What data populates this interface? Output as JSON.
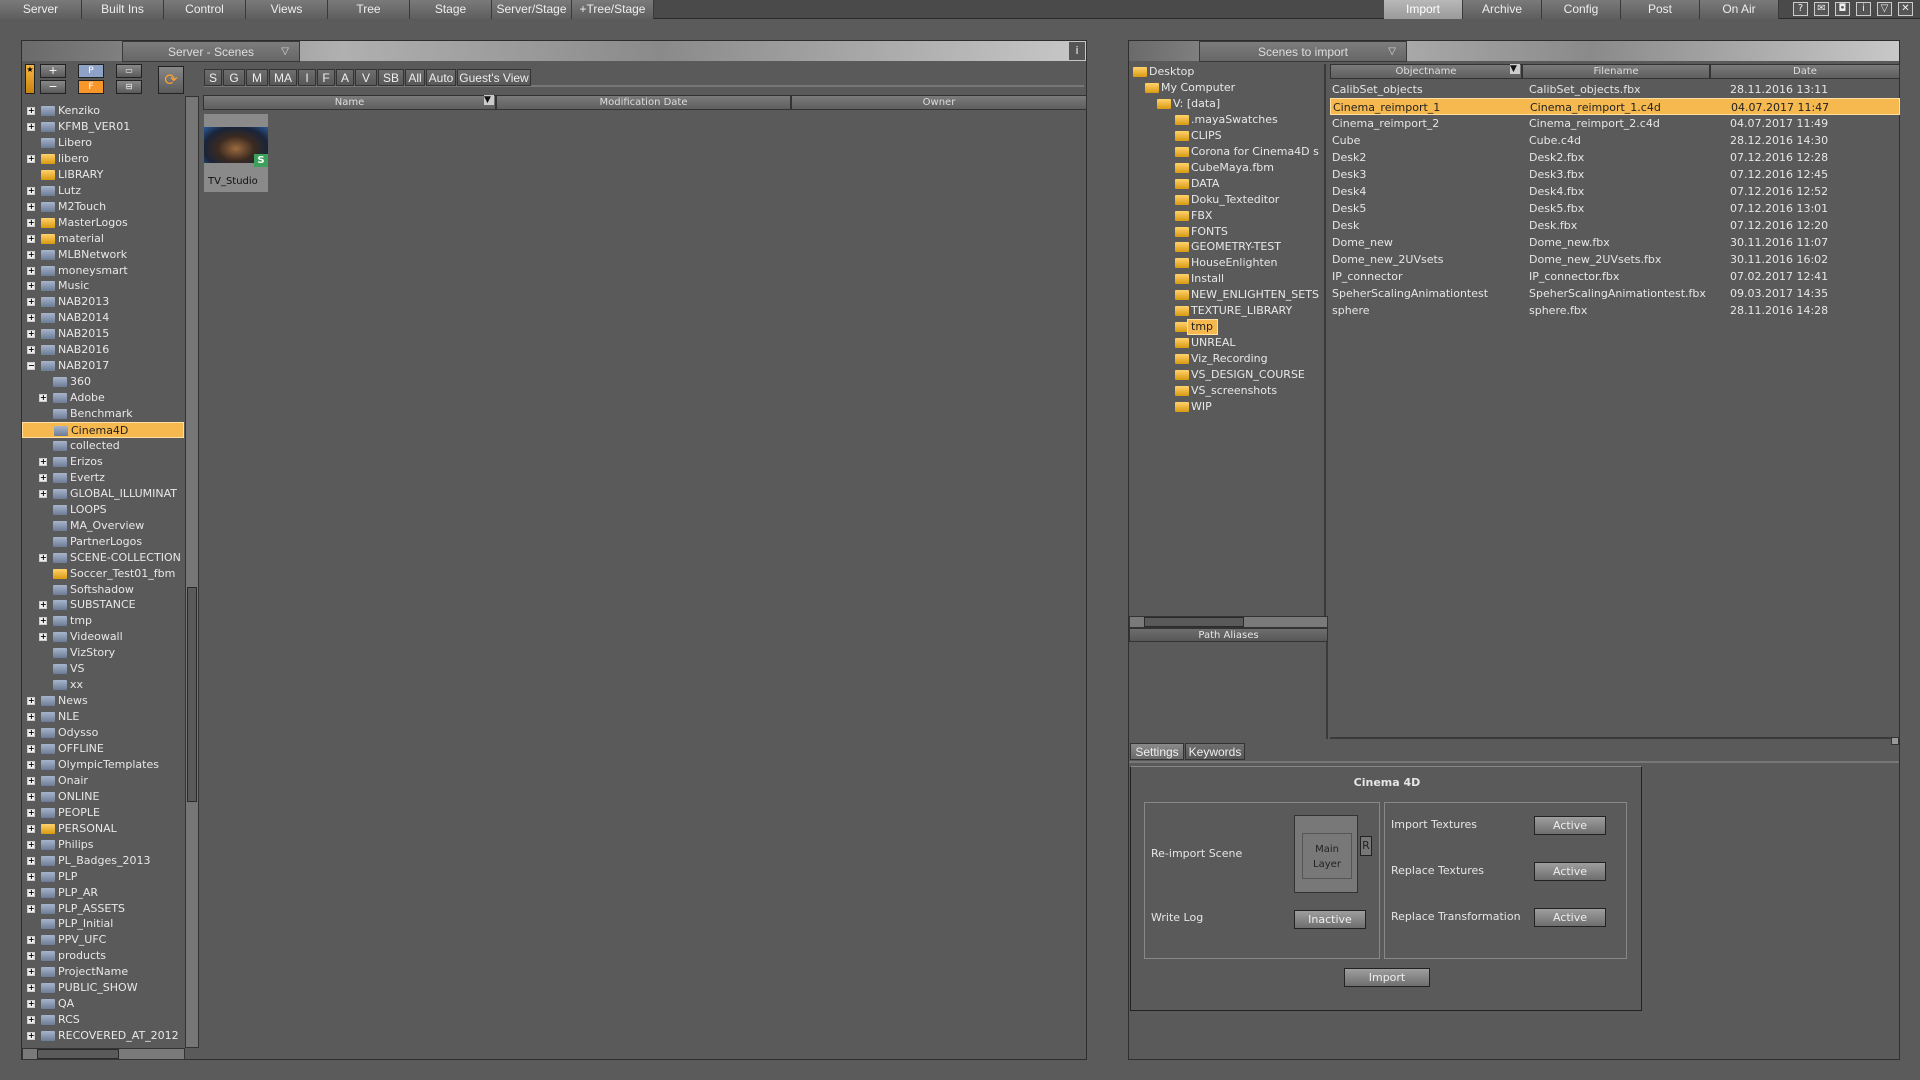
{
  "menubar": {
    "left_tabs": [
      "Server",
      "Built Ins",
      "Control",
      "Views",
      "Tree",
      "Stage",
      "Server/Stage",
      "+Tree/Stage"
    ],
    "right_tabs": [
      "Import",
      "Archive",
      "Config",
      "Post",
      "On Air"
    ],
    "active_tab": "Import",
    "window_icons": [
      "help-icon",
      "mail-icon",
      "camera-icon",
      "info-icon",
      "minimize-icon",
      "close-icon"
    ]
  },
  "server_panel": {
    "dropdown": "Server - Scenes",
    "info_label": "i",
    "filter_tabs": [
      "S",
      "G",
      "M",
      "MA",
      "I",
      "F",
      "A",
      "V",
      "SB",
      "All",
      "Auto",
      "Guest's View"
    ],
    "columns": [
      "Name",
      "Modification Date",
      "Owner"
    ],
    "thumbnail": {
      "label": "TV_Studio",
      "badge": "S"
    },
    "tree": [
      {
        "label": "Kenziko",
        "level": 0,
        "exp": "+",
        "color": "blue"
      },
      {
        "label": "KFMB_VER01",
        "level": 0,
        "exp": "+",
        "color": "blue"
      },
      {
        "label": "Libero",
        "level": 0,
        "exp": "",
        "color": "blue"
      },
      {
        "label": "libero",
        "level": 0,
        "exp": "+",
        "color": "yellow"
      },
      {
        "label": "LIBRARY",
        "level": 0,
        "exp": "",
        "color": "yellow"
      },
      {
        "label": "Lutz",
        "level": 0,
        "exp": "+",
        "color": "blue"
      },
      {
        "label": "M2Touch",
        "level": 0,
        "exp": "+",
        "color": "blue"
      },
      {
        "label": "MasterLogos",
        "level": 0,
        "exp": "+",
        "color": "yellow"
      },
      {
        "label": "material",
        "level": 0,
        "exp": "+",
        "color": "yellow"
      },
      {
        "label": "MLBNetwork",
        "level": 0,
        "exp": "+",
        "color": "blue"
      },
      {
        "label": "moneysmart",
        "level": 0,
        "exp": "+",
        "color": "blue"
      },
      {
        "label": "Music",
        "level": 0,
        "exp": "+",
        "color": "blue"
      },
      {
        "label": "NAB2013",
        "level": 0,
        "exp": "+",
        "color": "blue"
      },
      {
        "label": "NAB2014",
        "level": 0,
        "exp": "+",
        "color": "blue"
      },
      {
        "label": "NAB2015",
        "level": 0,
        "exp": "+",
        "color": "blue"
      },
      {
        "label": "NAB2016",
        "level": 0,
        "exp": "+",
        "color": "blue"
      },
      {
        "label": "NAB2017",
        "level": 0,
        "exp": "-",
        "color": "blue"
      },
      {
        "label": "360",
        "level": 1,
        "exp": "",
        "color": "blue"
      },
      {
        "label": "Adobe",
        "level": 1,
        "exp": "+",
        "color": "blue"
      },
      {
        "label": "Benchmark",
        "level": 1,
        "exp": "",
        "color": "blue"
      },
      {
        "label": "Cinema4D",
        "level": 1,
        "exp": "",
        "color": "blue",
        "selected": true
      },
      {
        "label": "collected",
        "level": 1,
        "exp": "",
        "color": "blue"
      },
      {
        "label": "Erizos",
        "level": 1,
        "exp": "+",
        "color": "blue"
      },
      {
        "label": "Evertz",
        "level": 1,
        "exp": "+",
        "color": "blue"
      },
      {
        "label": "GLOBAL_ILLUMINAT",
        "level": 1,
        "exp": "+",
        "color": "blue"
      },
      {
        "label": "LOOPS",
        "level": 1,
        "exp": "",
        "color": "blue"
      },
      {
        "label": "MA_Overview",
        "level": 1,
        "exp": "",
        "color": "blue"
      },
      {
        "label": "PartnerLogos",
        "level": 1,
        "exp": "",
        "color": "blue"
      },
      {
        "label": "SCENE-COLLECTION",
        "level": 1,
        "exp": "+",
        "color": "blue"
      },
      {
        "label": "Soccer_Test01_fbm",
        "level": 1,
        "exp": "",
        "color": "yellow"
      },
      {
        "label": "Softshadow",
        "level": 1,
        "exp": "",
        "color": "blue"
      },
      {
        "label": "SUBSTANCE",
        "level": 1,
        "exp": "+",
        "color": "blue"
      },
      {
        "label": "tmp",
        "level": 1,
        "exp": "+",
        "color": "blue"
      },
      {
        "label": "Videowall",
        "level": 1,
        "exp": "+",
        "color": "blue"
      },
      {
        "label": "VizStory",
        "level": 1,
        "exp": "",
        "color": "blue"
      },
      {
        "label": "VS",
        "level": 1,
        "exp": "",
        "color": "blue"
      },
      {
        "label": "xx",
        "level": 1,
        "exp": "",
        "color": "blue"
      },
      {
        "label": "News",
        "level": 0,
        "exp": "+",
        "color": "blue"
      },
      {
        "label": "NLE",
        "level": 0,
        "exp": "+",
        "color": "blue"
      },
      {
        "label": "Odysso",
        "level": 0,
        "exp": "+",
        "color": "blue"
      },
      {
        "label": "OFFLINE",
        "level": 0,
        "exp": "+",
        "color": "blue"
      },
      {
        "label": "OlympicTemplates",
        "level": 0,
        "exp": "+",
        "color": "blue"
      },
      {
        "label": "Onair",
        "level": 0,
        "exp": "+",
        "color": "blue"
      },
      {
        "label": "ONLINE",
        "level": 0,
        "exp": "+",
        "color": "blue"
      },
      {
        "label": "PEOPLE",
        "level": 0,
        "exp": "+",
        "color": "blue"
      },
      {
        "label": "PERSONAL",
        "level": 0,
        "exp": "+",
        "color": "yellow"
      },
      {
        "label": "Philips",
        "level": 0,
        "exp": "+",
        "color": "blue"
      },
      {
        "label": "PL_Badges_2013",
        "level": 0,
        "exp": "+",
        "color": "blue"
      },
      {
        "label": "PLP",
        "level": 0,
        "exp": "+",
        "color": "blue"
      },
      {
        "label": "PLP_AR",
        "level": 0,
        "exp": "+",
        "color": "blue"
      },
      {
        "label": "PLP_ASSETS",
        "level": 0,
        "exp": "+",
        "color": "blue"
      },
      {
        "label": "PLP_Initial",
        "level": 0,
        "exp": "",
        "color": "blue"
      },
      {
        "label": "PPV_UFC",
        "level": 0,
        "exp": "+",
        "color": "blue"
      },
      {
        "label": "products",
        "level": 0,
        "exp": "+",
        "color": "blue"
      },
      {
        "label": "ProjectName",
        "level": 0,
        "exp": "+",
        "color": "blue"
      },
      {
        "label": "PUBLIC_SHOW",
        "level": 0,
        "exp": "+",
        "color": "blue"
      },
      {
        "label": "QA",
        "level": 0,
        "exp": "+",
        "color": "blue"
      },
      {
        "label": "RCS",
        "level": 0,
        "exp": "+",
        "color": "blue"
      },
      {
        "label": "RECOVERED_AT_2012",
        "level": 0,
        "exp": "+",
        "color": "blue"
      }
    ]
  },
  "import_panel": {
    "dropdown": "Scenes to import",
    "folders": [
      {
        "label": "Desktop",
        "level": 0
      },
      {
        "label": "My Computer",
        "level": 1
      },
      {
        "label": "V: [data]",
        "level": 2
      },
      {
        "label": ".mayaSwatches",
        "level": 3
      },
      {
        "label": "CLIPS",
        "level": 3
      },
      {
        "label": "Corona for Cinema4D s",
        "level": 3
      },
      {
        "label": "CubeMaya.fbm",
        "level": 3
      },
      {
        "label": "DATA",
        "level": 3
      },
      {
        "label": "Doku_Texteditor",
        "level": 3
      },
      {
        "label": "FBX",
        "level": 3
      },
      {
        "label": "FONTS",
        "level": 3
      },
      {
        "label": "GEOMETRY-TEST",
        "level": 3
      },
      {
        "label": "HouseEnlighten",
        "level": 3
      },
      {
        "label": "Install",
        "level": 3
      },
      {
        "label": "NEW_ENLIGHTEN_SETS",
        "level": 3
      },
      {
        "label": "TEXTURE_LIBRARY",
        "level": 3
      },
      {
        "label": "tmp",
        "level": 3,
        "selected": true
      },
      {
        "label": "UNREAL",
        "level": 3
      },
      {
        "label": "Viz_Recording",
        "level": 3
      },
      {
        "label": "VS_DESIGN_COURSE",
        "level": 3
      },
      {
        "label": "VS_screenshots",
        "level": 3
      },
      {
        "label": "WIP",
        "level": 3
      }
    ],
    "path_aliases_label": "Path Aliases",
    "columns": [
      "Objectname",
      "Filename",
      "Date"
    ],
    "files": [
      {
        "name": "CalibSet_objects",
        "file": "CalibSet_objects.fbx",
        "date": "28.11.2016 13:11"
      },
      {
        "name": "Cinema_reimport_1",
        "file": "Cinema_reimport_1.c4d",
        "date": "04.07.2017 11:47",
        "selected": true
      },
      {
        "name": "Cinema_reimport_2",
        "file": "Cinema_reimport_2.c4d",
        "date": "04.07.2017 11:49"
      },
      {
        "name": "Cube",
        "file": "Cube.c4d",
        "date": "28.12.2016 14:30"
      },
      {
        "name": "Desk2",
        "file": "Desk2.fbx",
        "date": "07.12.2016 12:28"
      },
      {
        "name": "Desk3",
        "file": "Desk3.fbx",
        "date": "07.12.2016 12:45"
      },
      {
        "name": "Desk4",
        "file": "Desk4.fbx",
        "date": "07.12.2016 12:52"
      },
      {
        "name": "Desk5",
        "file": "Desk5.fbx",
        "date": "07.12.2016 13:01"
      },
      {
        "name": "Desk",
        "file": "Desk.fbx",
        "date": "07.12.2016 12:20"
      },
      {
        "name": "Dome_new",
        "file": "Dome_new.fbx",
        "date": "30.11.2016 11:07"
      },
      {
        "name": "Dome_new_2UVsets",
        "file": "Dome_new_2UVsets.fbx",
        "date": "30.11.2016 16:02"
      },
      {
        "name": "IP_connector",
        "file": "IP_connector.fbx",
        "date": "07.02.2017 12:41"
      },
      {
        "name": "SpeherScalingAnimationtest",
        "file": "SpeherScalingAnimationtest.fbx",
        "date": "09.03.2017 14:35"
      },
      {
        "name": "sphere",
        "file": "sphere.fbx",
        "date": "28.11.2016 14:28"
      }
    ],
    "settings_tabs": [
      "Settings",
      "Keywords"
    ],
    "settings": {
      "title": "Cinema 4D",
      "reimport_label": "Re-import Scene",
      "main_layer": "Main Layer",
      "r_button": "R",
      "write_log_label": "Write Log",
      "write_log_value": "Inactive",
      "import_textures_label": "Import Textures",
      "import_textures_value": "Active",
      "replace_textures_label": "Replace Textures",
      "replace_textures_value": "Active",
      "replace_transformation_label": "Replace Transformation",
      "replace_transformation_value": "Active",
      "import_button": "Import"
    }
  },
  "colors": {
    "selection": "#f6b94f",
    "background": "#5b5b5b",
    "folder_blue": "#8a98b0",
    "folder_yellow": "#f0b530"
  }
}
